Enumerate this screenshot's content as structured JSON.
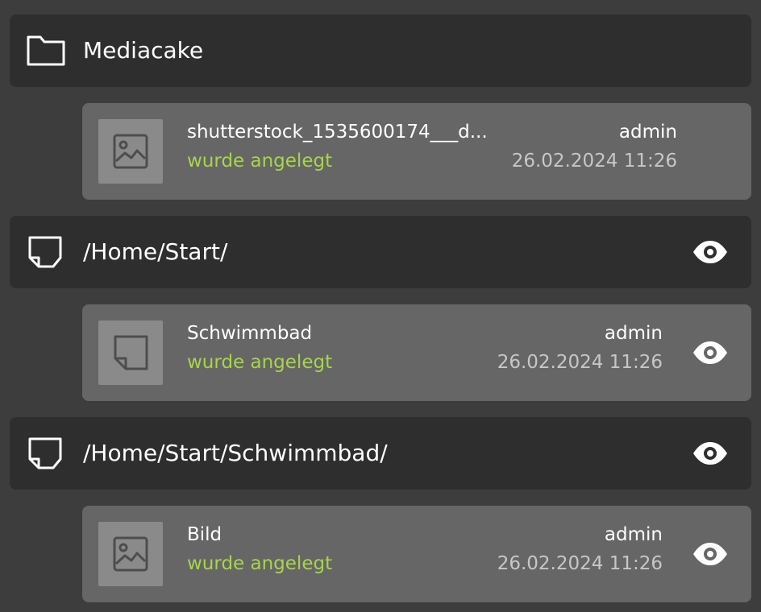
{
  "groups": [
    {
      "icon": "folder-icon",
      "title": "Mediacake",
      "has_eye": false,
      "entry": {
        "icon": "image-icon",
        "name": "shutterstock_1535600174___d...",
        "action": "wurde angelegt",
        "user": "admin",
        "date": "26.02.2024 11:26",
        "has_eye": false
      }
    },
    {
      "icon": "page-icon",
      "title": "/Home/Start/",
      "has_eye": true,
      "entry": {
        "icon": "page-icon",
        "name": "Schwimmbad",
        "action": "wurde angelegt",
        "user": "admin",
        "date": "26.02.2024 11:26",
        "has_eye": true
      }
    },
    {
      "icon": "page-icon",
      "title": "/Home/Start/Schwimmbad/",
      "has_eye": true,
      "entry": {
        "icon": "image-icon",
        "name": "Bild",
        "action": "wurde angelegt",
        "user": "admin",
        "date": "26.02.2024 11:26",
        "has_eye": true
      }
    }
  ],
  "colors": {
    "background": "#3d3d3d",
    "header_bg": "#2e2e2e",
    "entry_bg": "#666666",
    "thumb_bg": "#8a8a8a",
    "action_green": "#a8d44c",
    "date_gray": "#c7c7c7"
  }
}
